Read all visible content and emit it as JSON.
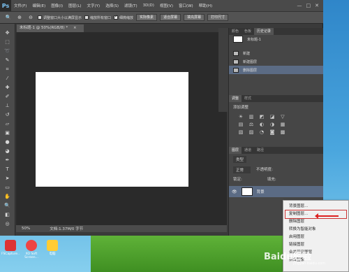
{
  "app": {
    "logo": "Ps"
  },
  "menubar": {
    "items": [
      "文件(F)",
      "编辑(E)",
      "图像(I)",
      "图层(L)",
      "文字(Y)",
      "选择(S)",
      "滤镜(T)",
      "3D(D)",
      "视图(V)",
      "窗口(W)",
      "帮助(H)"
    ],
    "window_buttons": [
      "—",
      "□",
      "✕"
    ]
  },
  "options": {
    "resize_window": "调整窗口大小以满屏显示",
    "zoom_all": "缩放所有窗口",
    "scrubby_zoom": "细微缩放",
    "actual_pixels": "实际像素",
    "fit_screen": "适合屏幕",
    "fill_screen": "填充屏幕",
    "print_size": "打印尺寸"
  },
  "document": {
    "tab_title": "未标题-1 @ 50%(RGB/8) *",
    "close_glyph": "×"
  },
  "status": {
    "zoom": "50%",
    "doc_info": "文档:1.37M/0 字节"
  },
  "history_panel": {
    "tabs": [
      "颜色",
      "色板",
      "历史记录"
    ],
    "snapshot": "未标题-1",
    "items": [
      "新建",
      "新建图层",
      "删除图层"
    ],
    "selected_index": 2
  },
  "adjustments_panel": {
    "tabs": [
      "调整",
      "样式"
    ],
    "title": "添加调整",
    "icons": [
      "☀",
      "▥",
      "◩",
      "◪",
      "▽",
      "▤",
      "⚖",
      "◐",
      "◑",
      "▦",
      "▧",
      "▨",
      "◔",
      "◙",
      "▩"
    ]
  },
  "layers_panel": {
    "tabs": [
      "图层",
      "通道",
      "路径"
    ],
    "filter": "类型",
    "blend_mode": "正常",
    "opacity_label": "不透明度:",
    "lock_label": "锁定:",
    "fill_label": "填充:",
    "layer_name": "背景"
  },
  "context_menu": {
    "items": [
      "背景图层...",
      "复制图层...",
      "删除图层",
      "转换为智能对象",
      "启用图层",
      "链接图层",
      "合并可见图层",
      "拼合图像"
    ],
    "highlighted_index": 1
  },
  "taskbar": {
    "icons": [
      {
        "label": "FSCapture..",
        "color": "#d33"
      },
      {
        "label": "XO Soft Screen...",
        "color": "#e44"
      },
      {
        "label": "电脑",
        "color": "#fc3"
      }
    ]
  },
  "watermark": {
    "text": "Baidu经验",
    "sub": "jingyan.baidu.com"
  }
}
